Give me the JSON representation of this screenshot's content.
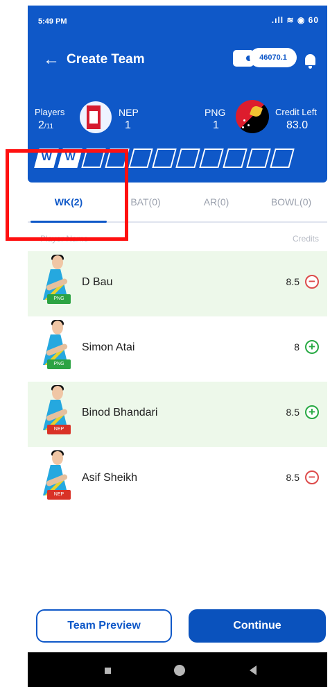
{
  "status_bar": {
    "time": "5:49 PM",
    "icons_text": ".ıll ≋ ◉ 60"
  },
  "header": {
    "title": "Create Team",
    "wallet_amount": "46070.1",
    "players_label": "Players",
    "players_count": "2",
    "players_total": "/11",
    "left_team_name": "NEP",
    "left_team_count": "1",
    "right_team_name": "PNG",
    "right_team_count": "1",
    "credit_label": "Credit Left",
    "credit_value": "83.0",
    "slots": [
      {
        "state": "filled",
        "mark": "W"
      },
      {
        "state": "filled",
        "mark": "W"
      },
      {
        "state": "empty",
        "mark": ""
      },
      {
        "state": "empty",
        "mark": ""
      },
      {
        "state": "empty",
        "mark": ""
      },
      {
        "state": "empty",
        "mark": ""
      },
      {
        "state": "empty",
        "mark": ""
      },
      {
        "state": "empty",
        "mark": ""
      },
      {
        "state": "empty",
        "mark": ""
      },
      {
        "state": "empty",
        "mark": ""
      },
      {
        "state": "empty",
        "mark": ""
      }
    ]
  },
  "tabs": [
    {
      "label": "WK(2)",
      "active": true
    },
    {
      "label": "BAT(0)",
      "active": false
    },
    {
      "label": "AR(0)",
      "active": false
    },
    {
      "label": "BOWL(0)",
      "active": false
    }
  ],
  "list_header": {
    "left": "Player Name",
    "right": "Credits"
  },
  "players": [
    {
      "name": "D Bau",
      "team": "PNG",
      "credit": "8.5",
      "selected": true,
      "action": "remove",
      "action_symbol": "−"
    },
    {
      "name": "Simon Atai",
      "team": "PNG",
      "credit": "8",
      "selected": false,
      "action": "add",
      "action_symbol": "+"
    },
    {
      "name": "Binod Bhandari",
      "team": "NEP",
      "credit": "8.5",
      "selected": true,
      "action": "add",
      "action_symbol": "+"
    },
    {
      "name": "Asif Sheikh",
      "team": "NEP",
      "credit": "8.5",
      "selected": false,
      "action": "remove",
      "action_symbol": "−"
    }
  ],
  "bottom": {
    "preview_label": "Team Preview",
    "continue_label": "Continue"
  },
  "colors": {
    "primary": "#0f58c8",
    "selected_row": "#edf8ea",
    "remove": "#dd4b4b",
    "add": "#27a943",
    "highlight": "#ff1010"
  }
}
